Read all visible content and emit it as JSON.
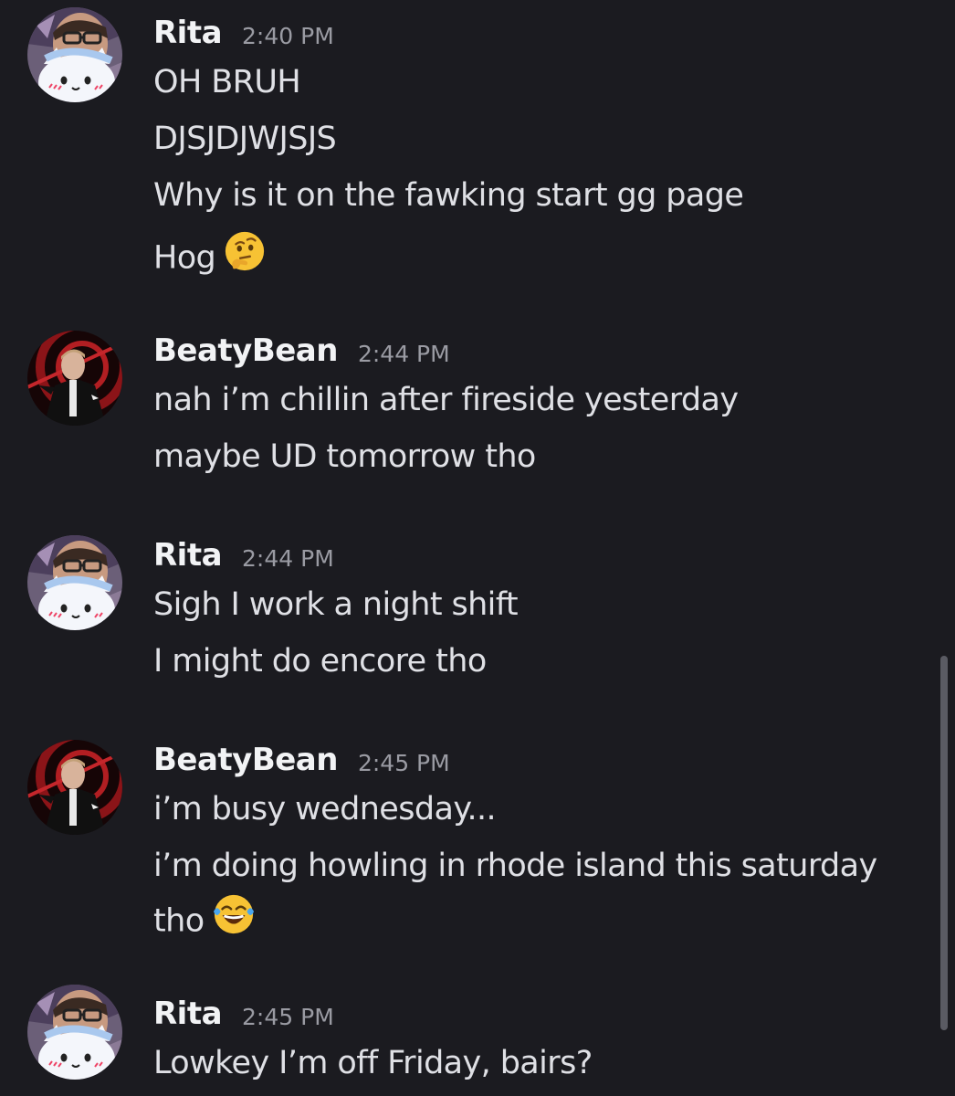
{
  "colors": {
    "background": "#1b1b20",
    "username": "#f2f3f5",
    "timestamp": "#9a9ba3",
    "message_text": "#dfe0e5",
    "scrollbar": "#5a5b63"
  },
  "messages": [
    {
      "author": "Rita",
      "time": "2:40 PM",
      "avatar": "rita-avatar",
      "lines": [
        "OH BRUH",
        "DJSJDJWJSJS",
        "Why is it on the fawking start gg page",
        "Hog"
      ],
      "emoji": "thinking-face"
    },
    {
      "author": "BeatyBean",
      "time": "2:44 PM",
      "avatar": "beatybean-avatar",
      "lines": [
        "nah i’m chillin after fireside yesterday",
        "maybe UD tomorrow tho"
      ]
    },
    {
      "author": "Rita",
      "time": "2:44 PM",
      "avatar": "rita-avatar",
      "lines": [
        "Sigh I work a night shift",
        "I might do encore tho"
      ]
    },
    {
      "author": "BeatyBean",
      "time": "2:45 PM",
      "avatar": "beatybean-avatar",
      "lines": [
        "i’m busy wednesday...",
        "i’m doing howling in rhode island this saturday",
        "tho"
      ],
      "emoji": "face-with-tears-of-joy"
    },
    {
      "author": "Rita",
      "time": "2:45 PM",
      "avatar": "rita-avatar",
      "lines": [
        "Lowkey I’m off Friday, bairs?"
      ]
    }
  ]
}
